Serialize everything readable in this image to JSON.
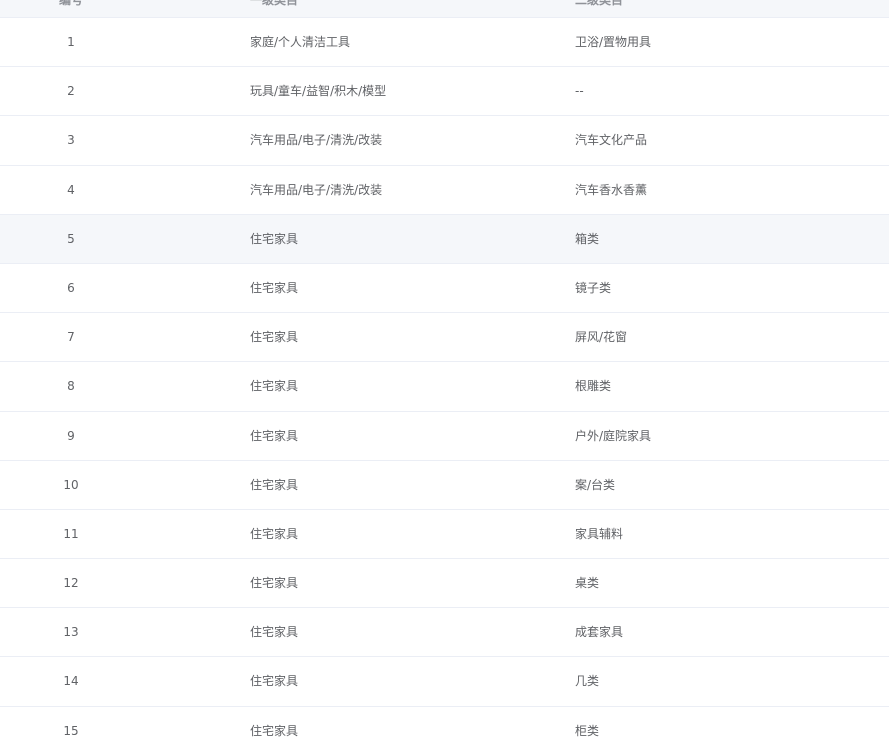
{
  "table": {
    "headers": {
      "id": "编号",
      "level1": "一级类目",
      "level2": "二级类目"
    },
    "highlighted_row_index": 4,
    "rows": [
      {
        "id": "1",
        "level1": "家庭/个人清洁工具",
        "level2": "卫浴/置物用具"
      },
      {
        "id": "2",
        "level1": "玩具/童车/益智/积木/模型",
        "level2": "--"
      },
      {
        "id": "3",
        "level1": "汽车用品/电子/清洗/改装",
        "level2": "汽车文化产品"
      },
      {
        "id": "4",
        "level1": "汽车用品/电子/清洗/改装",
        "level2": "汽车香水香薰"
      },
      {
        "id": "5",
        "level1": "住宅家具",
        "level2": "箱类"
      },
      {
        "id": "6",
        "level1": "住宅家具",
        "level2": "镜子类"
      },
      {
        "id": "7",
        "level1": "住宅家具",
        "level2": "屏风/花窗"
      },
      {
        "id": "8",
        "level1": "住宅家具",
        "level2": "根雕类"
      },
      {
        "id": "9",
        "level1": "住宅家具",
        "level2": "户外/庭院家具"
      },
      {
        "id": "10",
        "level1": "住宅家具",
        "level2": "案/台类"
      },
      {
        "id": "11",
        "level1": "住宅家具",
        "level2": "家具辅料"
      },
      {
        "id": "12",
        "level1": "住宅家具",
        "level2": "桌类"
      },
      {
        "id": "13",
        "level1": "住宅家具",
        "level2": "成套家具"
      },
      {
        "id": "14",
        "level1": "住宅家具",
        "level2": "几类"
      },
      {
        "id": "15",
        "level1": "住宅家具",
        "level2": "柜类"
      }
    ]
  }
}
